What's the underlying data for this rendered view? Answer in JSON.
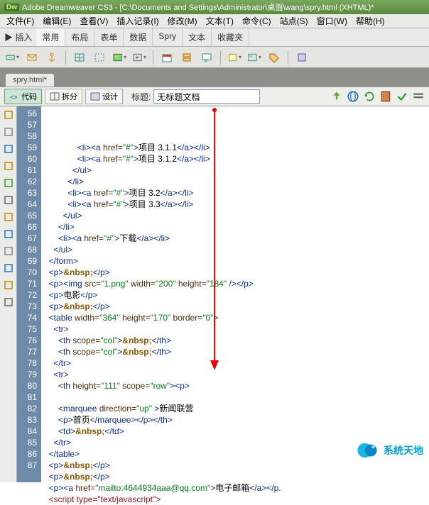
{
  "title": "Adobe Dreamweaver CS3 - [C:\\Documents and Settings\\Administrator\\桌面\\wang\\spry.html (XHTML)*",
  "dwlogo": "Dw",
  "menu": [
    "文件(F)",
    "编辑(E)",
    "查看(V)",
    "插入记录(I)",
    "修改(M)",
    "文本(T)",
    "命令(C)",
    "站点(S)",
    "窗口(W)",
    "帮助(H)"
  ],
  "insert_label": "▶ 插入",
  "insert_tabs": [
    "常用",
    "布局",
    "表单",
    "数据",
    "Spry",
    "文本",
    "收藏夹"
  ],
  "insert_active": "常用",
  "doc_tab": "spry.html*",
  "view_code": "代码",
  "view_split": "拆分",
  "view_design": "设计",
  "title_label": "标题:",
  "title_value": "无标题文档",
  "watermark": "系统天地",
  "gutter_icons": [
    "open",
    "pin",
    "hash",
    "star",
    "brace",
    "paren",
    "bolt",
    "search",
    "list",
    "grid",
    "pencil",
    "align"
  ],
  "lines": [
    {
      "n": 56,
      "i": 14,
      "seg": [
        {
          "c": "t-tag",
          "t": "<li><a"
        },
        {
          "c": "t-attr",
          "t": " href="
        },
        {
          "c": "t-val",
          "t": "\"#\""
        },
        {
          "c": "t-tag",
          "t": ">"
        },
        {
          "c": "t-text",
          "t": "项目 3.1.1"
        },
        {
          "c": "t-tag",
          "t": "</a></li>"
        }
      ]
    },
    {
      "n": 57,
      "i": 14,
      "seg": [
        {
          "c": "t-tag",
          "t": "<li><a"
        },
        {
          "c": "t-attr",
          "t": " href="
        },
        {
          "c": "t-val",
          "t": "\"#\""
        },
        {
          "c": "t-tag",
          "t": ">"
        },
        {
          "c": "t-text",
          "t": "项目 3.1.2"
        },
        {
          "c": "t-tag",
          "t": "</a></li>"
        }
      ]
    },
    {
      "n": 58,
      "i": 12,
      "seg": [
        {
          "c": "t-tag",
          "t": "</ul>"
        }
      ]
    },
    {
      "n": 59,
      "i": 10,
      "seg": [
        {
          "c": "t-tag",
          "t": "</li>"
        }
      ]
    },
    {
      "n": 60,
      "i": 10,
      "seg": [
        {
          "c": "t-tag",
          "t": "<li><a"
        },
        {
          "c": "t-attr",
          "t": " href="
        },
        {
          "c": "t-val",
          "t": "\"#\""
        },
        {
          "c": "t-tag",
          "t": ">"
        },
        {
          "c": "t-text",
          "t": "项目 3.2"
        },
        {
          "c": "t-tag",
          "t": "</a></li>"
        }
      ]
    },
    {
      "n": 61,
      "i": 10,
      "seg": [
        {
          "c": "t-tag",
          "t": "<li><a"
        },
        {
          "c": "t-attr",
          "t": " href="
        },
        {
          "c": "t-val",
          "t": "\"#\""
        },
        {
          "c": "t-tag",
          "t": ">"
        },
        {
          "c": "t-text",
          "t": "项目 3.3"
        },
        {
          "c": "t-tag",
          "t": "</a></li>"
        }
      ]
    },
    {
      "n": 62,
      "i": 8,
      "seg": [
        {
          "c": "t-tag",
          "t": "</ul>"
        }
      ]
    },
    {
      "n": 63,
      "i": 6,
      "seg": [
        {
          "c": "t-tag",
          "t": "</li>"
        }
      ]
    },
    {
      "n": 64,
      "i": 6,
      "seg": [
        {
          "c": "t-tag",
          "t": "<li><a"
        },
        {
          "c": "t-attr",
          "t": " href="
        },
        {
          "c": "t-val",
          "t": "\"#\""
        },
        {
          "c": "t-tag",
          "t": ">"
        },
        {
          "c": "t-text",
          "t": "下载"
        },
        {
          "c": "t-tag",
          "t": "</a></li>"
        }
      ]
    },
    {
      "n": 65,
      "i": 4,
      "seg": [
        {
          "c": "t-tag",
          "t": "</ul>"
        }
      ]
    },
    {
      "n": 66,
      "i": 2,
      "seg": [
        {
          "c": "t-tag",
          "t": "</form>"
        }
      ]
    },
    {
      "n": 67,
      "i": 2,
      "seg": [
        {
          "c": "t-tag",
          "t": "<p>"
        },
        {
          "c": "t-ent",
          "t": "&nbsp;"
        },
        {
          "c": "t-tag",
          "t": "</p>"
        }
      ]
    },
    {
      "n": 68,
      "i": 2,
      "seg": [
        {
          "c": "t-tag",
          "t": "<p><img"
        },
        {
          "c": "t-attr",
          "t": " src="
        },
        {
          "c": "t-val",
          "t": "\"1.png\""
        },
        {
          "c": "t-attr",
          "t": " width="
        },
        {
          "c": "t-val",
          "t": "\"200\""
        },
        {
          "c": "t-attr",
          "t": " height="
        },
        {
          "c": "t-val",
          "t": "\"184\""
        },
        {
          "c": "t-tag",
          "t": " /></p>"
        }
      ]
    },
    {
      "n": 69,
      "i": 2,
      "seg": [
        {
          "c": "t-tag",
          "t": "<p>"
        },
        {
          "c": "t-text",
          "t": "电影"
        },
        {
          "c": "t-tag",
          "t": "</p>"
        }
      ]
    },
    {
      "n": 70,
      "i": 2,
      "seg": [
        {
          "c": "t-tag",
          "t": "<p>"
        },
        {
          "c": "t-ent",
          "t": "&nbsp;"
        },
        {
          "c": "t-tag",
          "t": "</p>"
        }
      ]
    },
    {
      "n": 71,
      "i": 2,
      "seg": [
        {
          "c": "t-tag",
          "t": "<table"
        },
        {
          "c": "t-attr",
          "t": " width="
        },
        {
          "c": "t-val",
          "t": "\"364\""
        },
        {
          "c": "t-attr",
          "t": " height="
        },
        {
          "c": "t-val",
          "t": "\"170\""
        },
        {
          "c": "t-attr",
          "t": " border="
        },
        {
          "c": "t-val",
          "t": "\"0\""
        },
        {
          "c": "t-tag",
          "t": ">"
        }
      ]
    },
    {
      "n": 72,
      "i": 4,
      "seg": [
        {
          "c": "t-tag",
          "t": "<tr>"
        }
      ]
    },
    {
      "n": 73,
      "i": 6,
      "seg": [
        {
          "c": "t-tag",
          "t": "<th"
        },
        {
          "c": "t-attr",
          "t": " scope="
        },
        {
          "c": "t-val",
          "t": "\"col\""
        },
        {
          "c": "t-tag",
          "t": ">"
        },
        {
          "c": "t-ent",
          "t": "&nbsp;"
        },
        {
          "c": "t-tag",
          "t": "</th>"
        }
      ]
    },
    {
      "n": 74,
      "i": 6,
      "seg": [
        {
          "c": "t-tag",
          "t": "<th"
        },
        {
          "c": "t-attr",
          "t": " scope="
        },
        {
          "c": "t-val",
          "t": "\"col\""
        },
        {
          "c": "t-tag",
          "t": ">"
        },
        {
          "c": "t-ent",
          "t": "&nbsp;"
        },
        {
          "c": "t-tag",
          "t": "</th>"
        }
      ]
    },
    {
      "n": 75,
      "i": 4,
      "seg": [
        {
          "c": "t-tag",
          "t": "</tr>"
        }
      ]
    },
    {
      "n": 76,
      "i": 4,
      "seg": [
        {
          "c": "t-tag",
          "t": "<tr>"
        }
      ]
    },
    {
      "n": 77,
      "i": 6,
      "seg": [
        {
          "c": "t-tag",
          "t": "<th"
        },
        {
          "c": "t-attr",
          "t": " height="
        },
        {
          "c": "t-val",
          "t": "\"111\""
        },
        {
          "c": "t-attr",
          "t": " scope="
        },
        {
          "c": "t-val",
          "t": "\"row\""
        },
        {
          "c": "t-tag",
          "t": "><p>"
        }
      ]
    },
    {
      "n": 78,
      "i": 0,
      "seg": [
        {
          "c": "t-text",
          "t": " "
        }
      ]
    },
    {
      "n": 79,
      "i": 6,
      "seg": [
        {
          "c": "t-tag",
          "t": "<marquee"
        },
        {
          "c": "t-attr",
          "t": " direction="
        },
        {
          "c": "t-val",
          "t": "\"up\""
        },
        {
          "c": "t-tag",
          "t": " >"
        },
        {
          "c": "t-text",
          "t": "新闻联营"
        }
      ]
    },
    {
      "n": 80,
      "i": 6,
      "seg": [
        {
          "c": "t-tag",
          "t": "<p>"
        },
        {
          "c": "t-text",
          "t": "首页"
        },
        {
          "c": "t-tag",
          "t": "</marquee></p></th>"
        }
      ]
    },
    {
      "n": 81,
      "i": 6,
      "seg": [
        {
          "c": "t-tag",
          "t": "<td>"
        },
        {
          "c": "t-ent",
          "t": "&nbsp;"
        },
        {
          "c": "t-tag",
          "t": "</td>"
        }
      ]
    },
    {
      "n": 82,
      "i": 4,
      "seg": [
        {
          "c": "t-tag",
          "t": "</tr>"
        }
      ]
    },
    {
      "n": 83,
      "i": 2,
      "seg": [
        {
          "c": "t-tag",
          "t": "</table>"
        }
      ]
    },
    {
      "n": 84,
      "i": 2,
      "seg": [
        {
          "c": "t-tag",
          "t": "<p>"
        },
        {
          "c": "t-ent",
          "t": "&nbsp;"
        },
        {
          "c": "t-tag",
          "t": "</p>"
        }
      ]
    },
    {
      "n": 85,
      "i": 2,
      "seg": [
        {
          "c": "t-tag",
          "t": "<p>"
        },
        {
          "c": "t-ent",
          "t": "&nbsp;"
        },
        {
          "c": "t-tag",
          "t": "</p>"
        }
      ]
    },
    {
      "n": 86,
      "i": 2,
      "seg": [
        {
          "c": "t-tag",
          "t": "<p><a"
        },
        {
          "c": "t-attr",
          "t": " href="
        },
        {
          "c": "t-val",
          "t": "\"mailto:4644934aaa@qq.com\""
        },
        {
          "c": "t-tag",
          "t": ">"
        },
        {
          "c": "t-text",
          "t": "电子邮箱"
        },
        {
          "c": "t-tag",
          "t": "</a></p."
        }
      ]
    },
    {
      "n": 87,
      "i": 2,
      "seg": [
        {
          "c": "t-script",
          "t": "<script type=\"text/javascript\">"
        }
      ]
    }
  ]
}
